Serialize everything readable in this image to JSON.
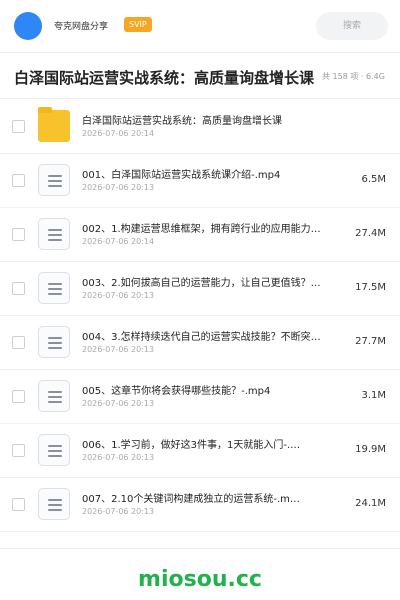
{
  "header": {
    "brand": "夸克网盘分享",
    "vip_badge": "SVIP",
    "search_placeholder": "搜索"
  },
  "share": {
    "title": "白泽国际站运营实战系统：高质量询盘增长课",
    "meta": "共 158 项 · 6.4G"
  },
  "files": [
    {
      "type": "folder",
      "name": "白泽国际站运营实战系统：高质量询盘增长课",
      "date": "2026-07-06 20:14",
      "size": ""
    },
    {
      "type": "file",
      "name": "001、白泽国际站运营实战系统课介绍-.mp4",
      "date": "2026-07-06 20:13",
      "size": "6.5M"
    },
    {
      "type": "file",
      "name": "002、1.构建运营思维框架，拥有跨行业的应用能力…",
      "date": "2026-07-06 20:14",
      "size": "27.4M"
    },
    {
      "type": "file",
      "name": "003、2.如何拔高自己的运营能力，让自己更值钱？…",
      "date": "2026-07-06 20:13",
      "size": "17.5M"
    },
    {
      "type": "file",
      "name": "004、3.怎样持续迭代自己的运营实战技能？不断突…",
      "date": "2026-07-06 20:13",
      "size": "27.7M"
    },
    {
      "type": "file",
      "name": "005、这章节你将会获得哪些技能？-.mp4",
      "date": "2026-07-06 20:13",
      "size": "3.1M"
    },
    {
      "type": "file",
      "name": "006、1.学习前，做好这3件事，1天就能入门-.…",
      "date": "2026-07-06 20:13",
      "size": "19.9M"
    },
    {
      "type": "file",
      "name": "007、2.10个关键词构建成独立的运营系统-.m…",
      "date": "2026-07-06 20:13",
      "size": "24.1M"
    }
  ],
  "footer": {
    "watermark": "miosou.cc"
  }
}
